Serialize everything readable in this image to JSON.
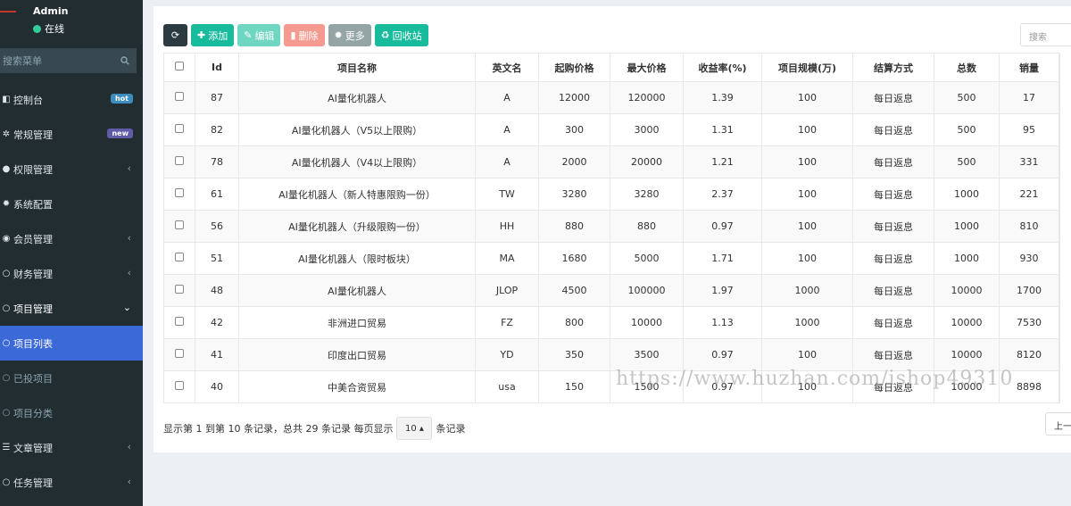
{
  "user": {
    "name": "Admin",
    "status": "在线"
  },
  "sidebar": {
    "search_placeholder": "搜索菜单",
    "items": [
      {
        "label": "控制台",
        "icon": "dashboard-icon",
        "badge": "hot",
        "badge_color": "#3c8dbc"
      },
      {
        "label": "常规管理",
        "icon": "cogs-icon",
        "badge": "new",
        "badge_color": "#605ca8"
      },
      {
        "label": "权限管理",
        "icon": "group-icon"
      },
      {
        "label": "系统配置",
        "icon": "cog-icon"
      },
      {
        "label": "会员管理",
        "icon": "user-icon"
      },
      {
        "label": "财务管理",
        "icon": "circle-icon"
      },
      {
        "label": "项目管理",
        "icon": "circle-icon"
      },
      {
        "label": "项目列表",
        "icon": "circle-icon"
      },
      {
        "label": "已投项目",
        "icon": "circle-icon"
      },
      {
        "label": "项目分类",
        "icon": "circle-icon"
      },
      {
        "label": "文章管理",
        "icon": "list-icon"
      },
      {
        "label": "任务管理",
        "icon": "circle-icon"
      }
    ]
  },
  "toolbar": {
    "refresh_color": "#2c3b41",
    "add_label": "添加",
    "add_color": "#18bc9c",
    "edit_label": "编辑",
    "edit_color": "#6fd6c1",
    "delete_label": "删除",
    "delete_color": "#f59a8f",
    "more_label": "更多",
    "more_color": "#95a5a6",
    "recycle_label": "回收站",
    "recycle_color": "#18bc9c",
    "search_placeholder": "搜索"
  },
  "table": {
    "headers": [
      "Id",
      "项目名称",
      "英文名",
      "起购价格",
      "最大价格",
      "收益率(%)",
      "项目规模(万)",
      "结算方式",
      "总数",
      "销量"
    ],
    "rows": [
      [
        "87",
        "AI量化机器人",
        "A",
        "12000",
        "120000",
        "1.39",
        "100",
        "每日返息",
        "500",
        "17"
      ],
      [
        "82",
        "AI量化机器人（V5以上限购）",
        "A",
        "300",
        "3000",
        "1.31",
        "100",
        "每日返息",
        "500",
        "95"
      ],
      [
        "78",
        "AI量化机器人（V4以上限购）",
        "A",
        "2000",
        "20000",
        "1.21",
        "100",
        "每日返息",
        "500",
        "331"
      ],
      [
        "61",
        "AI量化机器人（新人特惠限购一份）",
        "TW",
        "3280",
        "3280",
        "2.37",
        "100",
        "每日返息",
        "1000",
        "221"
      ],
      [
        "56",
        "AI量化机器人（升级限购一份）",
        "HH",
        "880",
        "880",
        "0.97",
        "100",
        "每日返息",
        "1000",
        "810"
      ],
      [
        "51",
        "AI量化机器人（限时板块）",
        "MA",
        "1680",
        "5000",
        "1.71",
        "100",
        "每日返息",
        "1000",
        "930"
      ],
      [
        "48",
        "AI量化机器人",
        "JLOP",
        "4500",
        "100000",
        "1.97",
        "1000",
        "每日返息",
        "10000",
        "1700"
      ],
      [
        "42",
        "非洲进口贸易",
        "FZ",
        "800",
        "10000",
        "1.13",
        "1000",
        "每日返息",
        "10000",
        "7530"
      ],
      [
        "41",
        "印度出口贸易",
        "YD",
        "350",
        "3500",
        "0.97",
        "100",
        "每日返息",
        "10000",
        "8120"
      ],
      [
        "40",
        "中美合资贸易",
        "usa",
        "150",
        "1500",
        "0.97",
        "100",
        "每日返息",
        "10000",
        "8898"
      ]
    ]
  },
  "footer": {
    "summary": "显示第 1 到第 10 条记录，总共 29 条记录 每页显示",
    "page_size": "10 ▴",
    "suffix": "条记录",
    "prev_label": "上一"
  },
  "watermark": "https://www.huzhan.com/ishop49310"
}
